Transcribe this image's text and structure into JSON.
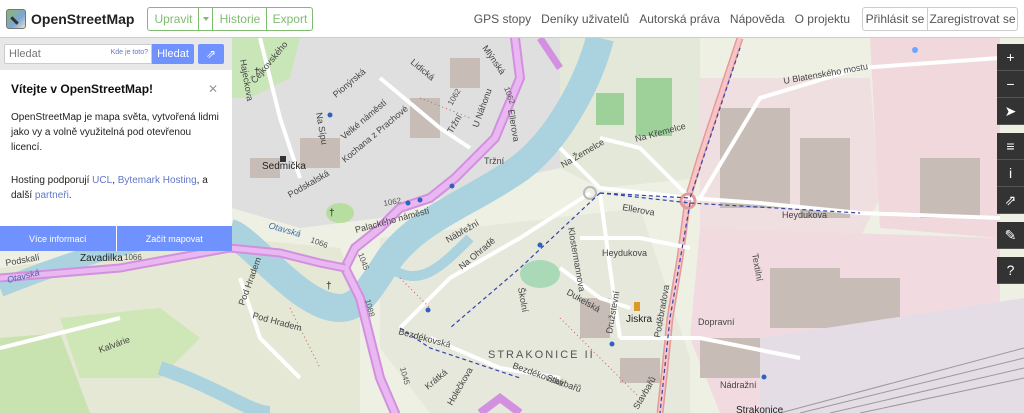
{
  "app": {
    "title": "OpenStreetMap"
  },
  "toolbar": {
    "edit_label": "Upravit",
    "history_label": "Historie",
    "export_label": "Export"
  },
  "nav": {
    "items": [
      "GPS stopy",
      "Deníky uživatelů",
      "Autorská práva",
      "Nápověda",
      "O projektu"
    ]
  },
  "auth": {
    "login_label": "Přihlásit se",
    "register_label": "Zaregistrovat se"
  },
  "search": {
    "placeholder": "Hledat",
    "where_link": "Kde je toto?",
    "button_label": "Hledat"
  },
  "welcome": {
    "title": "Vítejte v OpenStreetMap!",
    "intro": "OpenStreetMap je mapa světa, vytvořená lidmi jako vy a volně využitelná pod otevřenou licencí.",
    "hosting_prefix": "Hosting podporují",
    "ucl": "UCL",
    "sep1": ",",
    "bytemark": "Bytemark Hosting",
    "sep2": ", a další",
    "partners": "partneři",
    "end": ".",
    "more_label": "Více informací",
    "start_label": "Začít mapovat"
  },
  "controls": {
    "zoom_in": "+",
    "zoom_out": "−",
    "locate": "➤",
    "layers": "≡",
    "info": "i",
    "share": "⇗",
    "note": "✎",
    "query": "?"
  },
  "map_labels": {
    "place_sedmicka": "Sedmička",
    "place_zavadilka": "Zavadilka",
    "place_jiskra": "Jiskra",
    "district": "STRAKONICE II",
    "town": "Strakonice",
    "river_otavska1": "Otavská",
    "river_otavska2": "Otavská",
    "road_1062a": "1062",
    "road_1062b": "1062",
    "road_1062c": "1062",
    "road_1066": "1066",
    "road_1066b": "1066",
    "road_1045": "1045",
    "road_1088": "1088",
    "road_1045b": "1045",
    "street_cejkovskeho": "Čejkovského",
    "street_hajeckova": "Hajeckova",
    "street_lidicka": "Lidická",
    "street_mlynska": "Mlýnská",
    "street_pionyrska": "Pionýrská",
    "street_velke_namesti": "Velké náměstí",
    "street_kochana": "Kochana z Prachové",
    "street_u_nahonu": "U Náhonu",
    "street_ellerova": "Ellerova",
    "street_trzni": "Tržní",
    "street_trzni2": "Tržní",
    "street_nasipy": "Na Sípu",
    "street_podskalska": "Podskalská",
    "street_palackeho": "Palackého náměstí",
    "street_nabrezni": "Nábřežní",
    "street_na_ohrade": "Na Ohradě",
    "street_na_zemelce": "Na Žemelce",
    "street_na_kremelce": "Na Křemelce",
    "street_ellerova2": "Ellerova",
    "street_klosterman": "Klostermannova",
    "street_skolni": "Školní",
    "street_dukelska": "Dukelská",
    "street_heydukova": "Heydukova",
    "street_heydukova2": "Heydukova",
    "street_u_blatenskeho": "U Blatenského mostu",
    "street_textilni": "Textilní",
    "street_dopravni": "Dopravní",
    "street_nadrazni": "Nádražní",
    "street_podskali": "Podskalí",
    "street_pod_hradem": "Pod Hradem",
    "street_pod_hradem2": "Pod Hradem",
    "street_kalvarie": "Kalvárie",
    "street_bezdekovska": "Bezdékovská",
    "street_bezdekovska2": "Bezdékovská",
    "street_kratka": "Krátká",
    "street_holeckova": "Holečkova",
    "street_podebradova": "Poděbradova",
    "street_stavbaru": "Stavbařů",
    "street_stavbaru2": "Stavbařů",
    "street_druzstevni": "Družstevní",
    "street_otavska_rd": "Otavská"
  }
}
